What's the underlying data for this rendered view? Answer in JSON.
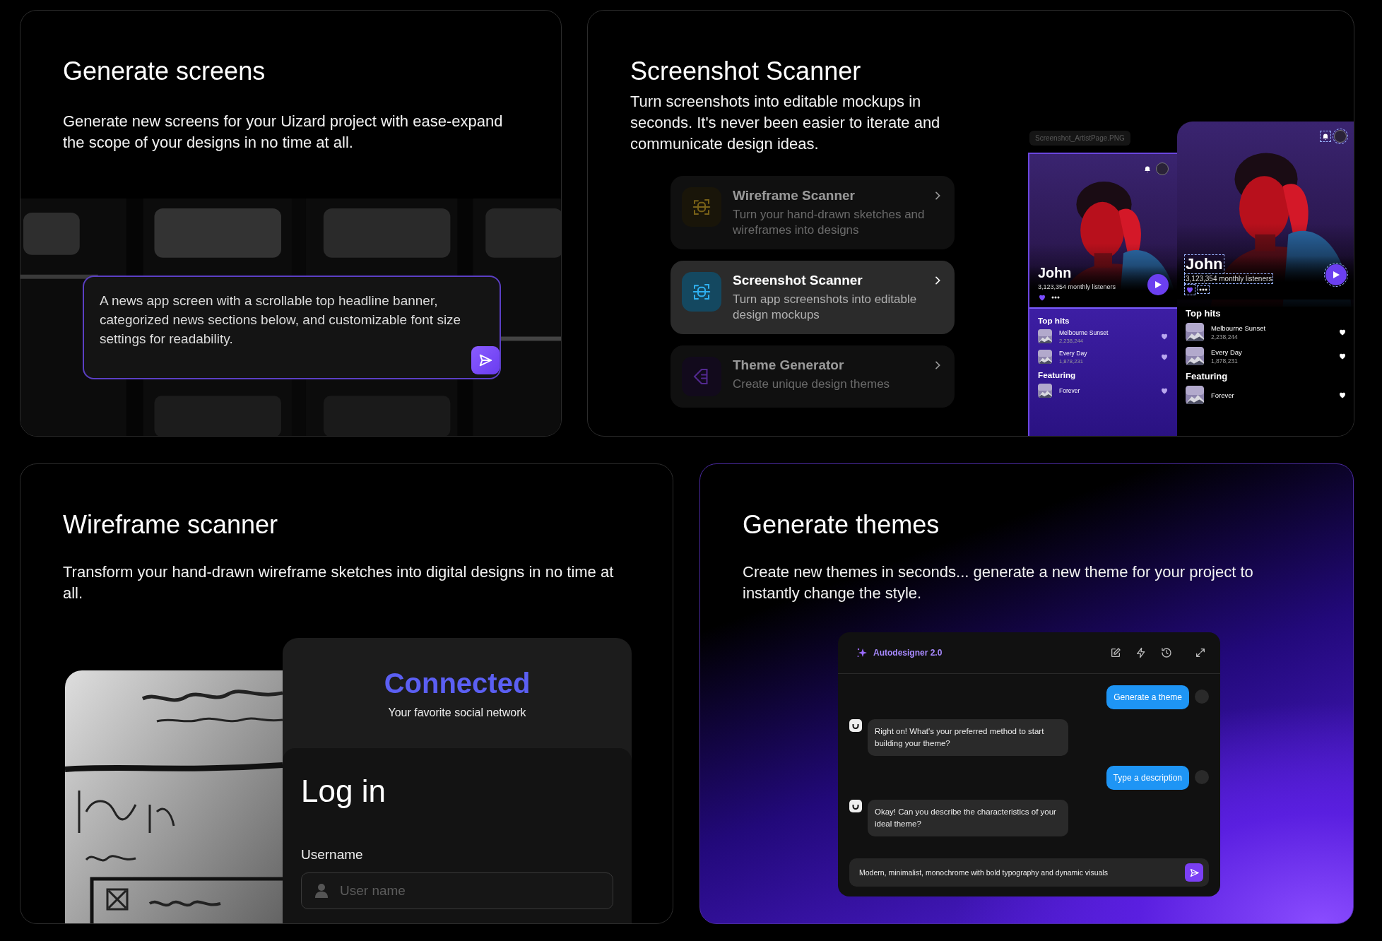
{
  "screens_card": {
    "title": "Generate screens",
    "description": "Generate new screens for your Uizard project with ease-expand the scope of your designs in no time at all.",
    "prompt": "A news app screen with a scrollable top headline banner, categorized news sections below, and customizable font size settings for readability."
  },
  "scanner_card": {
    "title": "Screenshot Scanner",
    "description": "Turn screenshots into editable mockups in seconds. It's never been easier to iterate and communicate design ideas.",
    "features": [
      {
        "kind": "sketch",
        "title": "Wireframe Scanner",
        "description": "Turn your hand-drawn sketches and wireframes into designs",
        "selected": false
      },
      {
        "kind": "scan",
        "title": "Screenshot Scanner",
        "description": "Turn app screenshots into editable design mockups",
        "selected": true
      },
      {
        "kind": "theme",
        "title": "Theme Generator",
        "description": "Create unique design themes",
        "selected": false
      }
    ],
    "phones": [
      {
        "kind": "source",
        "file_label": "Screenshot_ArtistPage.PNG",
        "artist": "John",
        "listeners": "3,123,354 monthly listeners",
        "sections": [
          {
            "title": "Top hits",
            "tracks": [
              {
                "title": "Melbourne Sunset",
                "plays": "2,238,244"
              },
              {
                "title": "Every Day",
                "plays": "1,878,231"
              }
            ]
          },
          {
            "title": "Featuring",
            "tracks": [
              {
                "title": "Forever"
              }
            ]
          }
        ]
      },
      {
        "kind": "scanned",
        "artist": "John",
        "listeners": "3,123,354 monthly listeners",
        "sections": [
          {
            "title": "Top hits",
            "tracks": [
              {
                "title": "Melbourne Sunset",
                "plays": "2,238,244"
              },
              {
                "title": "Every Day",
                "plays": "1,878,231"
              }
            ]
          },
          {
            "title": "Featuring",
            "tracks": [
              {
                "title": "Forever"
              }
            ]
          }
        ]
      }
    ]
  },
  "wireframe_card": {
    "title": "Wireframe scanner",
    "description": "Transform your hand-drawn wireframe sketches into digital designs in no time at all.",
    "mockup": {
      "brand": "Connected",
      "tagline": "Your favorite social network",
      "heading": "Log in",
      "field_label": "Username",
      "field_placeholder": "User name"
    }
  },
  "themes_card": {
    "title": "Generate themes",
    "description": "Create new themes in seconds... generate a new theme for your project to instantly change the style.",
    "chat": {
      "title": "Autodesigner 2.0",
      "messages": [
        {
          "kind": "user",
          "text": "Generate a theme"
        },
        {
          "kind": "bot",
          "text": "Right on! What's your preferred method to start building your theme?"
        },
        {
          "kind": "user",
          "text": "Type a description"
        },
        {
          "kind": "bot",
          "text": "Okay! Can you describe the characteristics of your ideal theme?"
        }
      ],
      "input_value": "Modern, minimalist, monochrome with bold typography and dynamic visuals"
    }
  }
}
